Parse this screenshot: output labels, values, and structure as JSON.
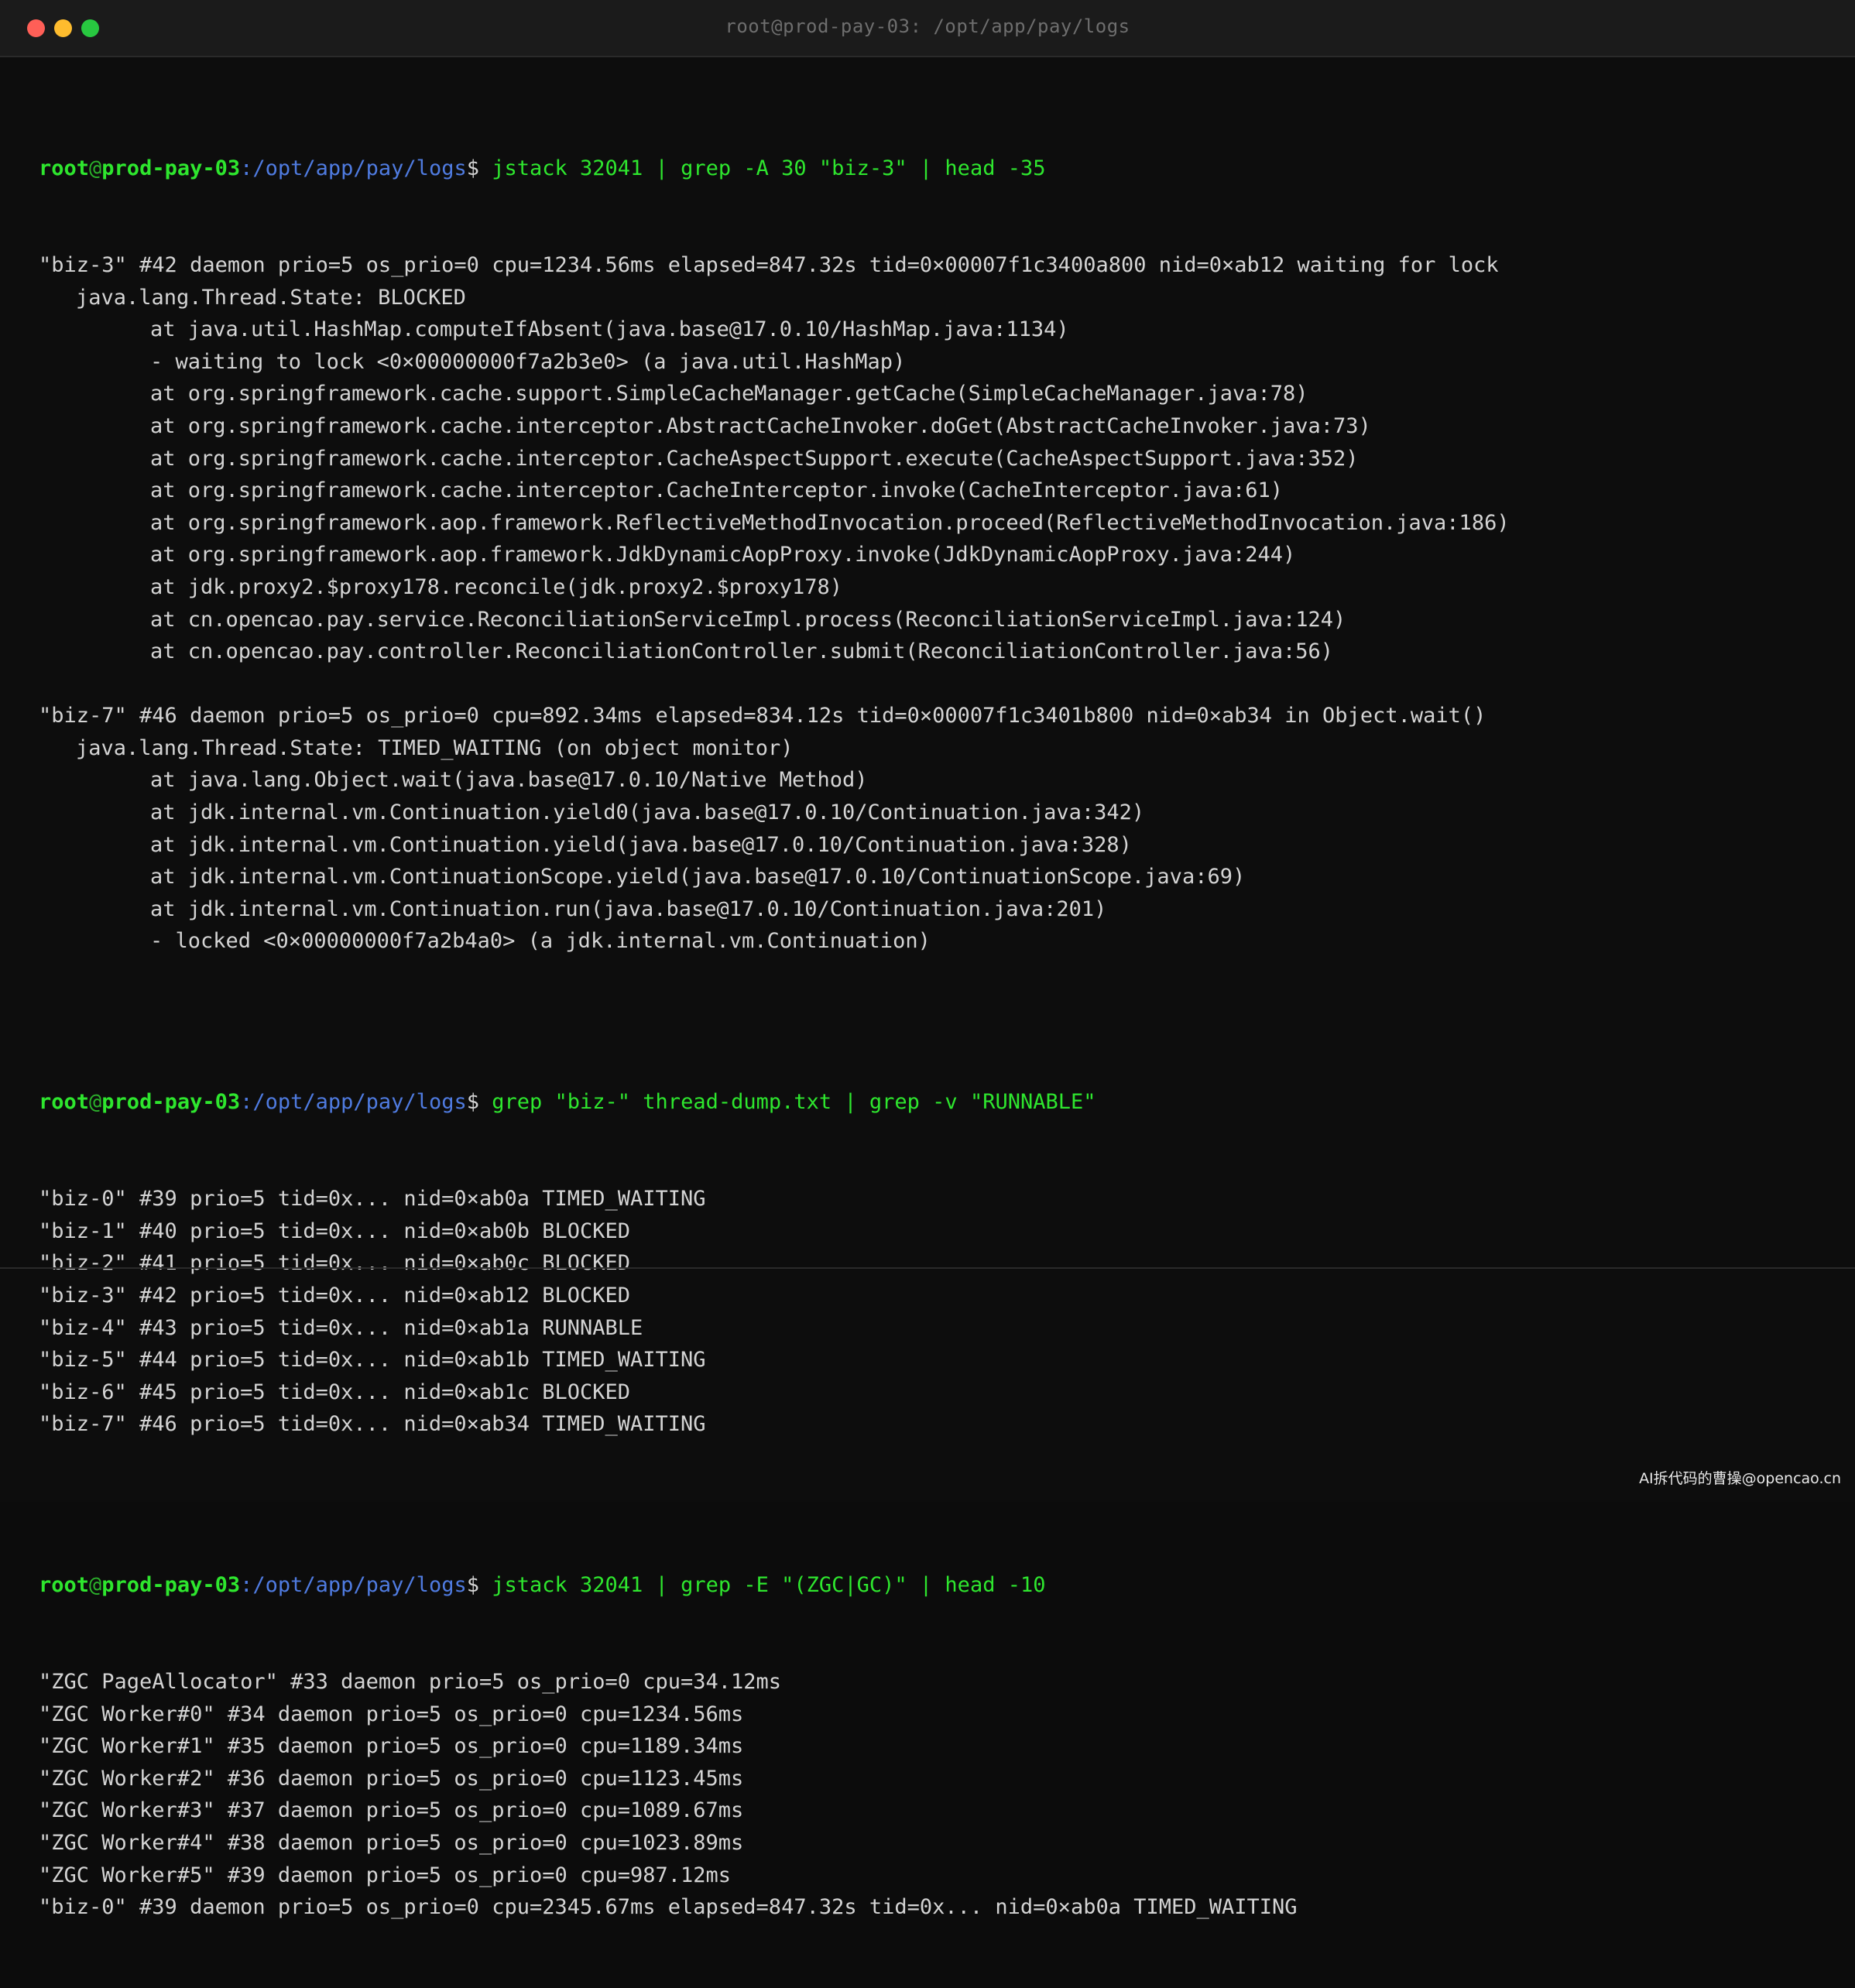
{
  "window": {
    "title": "root@prod-pay-03: /opt/app/pay/logs"
  },
  "prompt": {
    "user": "root",
    "at": "@",
    "host": "prod-pay-03",
    "path": ":/opt/app/pay/logs",
    "dollar": "$ "
  },
  "commands": {
    "cmd1": "jstack 32041 | grep -A 30 \"biz-3\" | head -35",
    "cmd2": "grep \"biz-\" thread-dump.txt | grep -v \"RUNNABLE\"",
    "cmd3": "jstack 32041 | grep -E \"(ZGC|GC)\" | head -10"
  },
  "block1": [
    {
      "indent": 0,
      "text": "\"biz-3\" #42 daemon prio=5 os_prio=0 cpu=1234.56ms elapsed=847.32s tid=0×00007f1c3400a800 nid=0×ab12 waiting for lock"
    },
    {
      "indent": 1,
      "text": "java.lang.Thread.State: BLOCKED"
    },
    {
      "indent": 2,
      "text": "at java.util.HashMap.computeIfAbsent(java.base@17.0.10/HashMap.java:1134)"
    },
    {
      "indent": 2,
      "text": "- waiting to lock <0×00000000f7a2b3e0> (a java.util.HashMap)"
    },
    {
      "indent": 2,
      "text": "at org.springframework.cache.support.SimpleCacheManager.getCache(SimpleCacheManager.java:78)"
    },
    {
      "indent": 2,
      "text": "at org.springframework.cache.interceptor.AbstractCacheInvoker.doGet(AbstractCacheInvoker.java:73)"
    },
    {
      "indent": 2,
      "text": "at org.springframework.cache.interceptor.CacheAspectSupport.execute(CacheAspectSupport.java:352)"
    },
    {
      "indent": 2,
      "text": "at org.springframework.cache.interceptor.CacheInterceptor.invoke(CacheInterceptor.java:61)"
    },
    {
      "indent": 2,
      "text": "at org.springframework.aop.framework.ReflectiveMethodInvocation.proceed(ReflectiveMethodInvocation.java:186)"
    },
    {
      "indent": 2,
      "text": "at org.springframework.aop.framework.JdkDynamicAopProxy.invoke(JdkDynamicAopProxy.java:244)"
    },
    {
      "indent": 2,
      "text": "at jdk.proxy2.$proxy178.reconcile(jdk.proxy2.$proxy178)"
    },
    {
      "indent": 2,
      "text": "at cn.opencao.pay.service.ReconciliationServiceImpl.process(ReconciliationServiceImpl.java:124)"
    },
    {
      "indent": 2,
      "text": "at cn.opencao.pay.controller.ReconciliationController.submit(ReconciliationController.java:56)"
    },
    {
      "indent": 0,
      "text": ""
    },
    {
      "indent": 0,
      "text": "\"biz-7\" #46 daemon prio=5 os_prio=0 cpu=892.34ms elapsed=834.12s tid=0×00007f1c3401b800 nid=0×ab34 in Object.wait()"
    },
    {
      "indent": 1,
      "text": "java.lang.Thread.State: TIMED_WAITING (on object monitor)"
    },
    {
      "indent": 2,
      "text": "at java.lang.Object.wait(java.base@17.0.10/Native Method)"
    },
    {
      "indent": 2,
      "text": "at jdk.internal.vm.Continuation.yield0(java.base@17.0.10/Continuation.java:342)"
    },
    {
      "indent": 2,
      "text": "at jdk.internal.vm.Continuation.yield(java.base@17.0.10/Continuation.java:328)"
    },
    {
      "indent": 2,
      "text": "at jdk.internal.vm.ContinuationScope.yield(java.base@17.0.10/ContinuationScope.java:69)"
    },
    {
      "indent": 2,
      "text": "at jdk.internal.vm.Continuation.run(java.base@17.0.10/Continuation.java:201)"
    },
    {
      "indent": 2,
      "text": "- locked <0×00000000f7a2b4a0> (a jdk.internal.vm.Continuation)"
    },
    {
      "indent": 0,
      "text": ""
    }
  ],
  "block2": [
    {
      "indent": 0,
      "text": "\"biz-0\" #39 prio=5 tid=0x... nid=0×ab0a TIMED_WAITING"
    },
    {
      "indent": 0,
      "text": "\"biz-1\" #40 prio=5 tid=0x... nid=0×ab0b BLOCKED"
    },
    {
      "indent": 0,
      "text": "\"biz-2\" #41 prio=5 tid=0x... nid=0×ab0c BLOCKED"
    },
    {
      "indent": 0,
      "text": "\"biz-3\" #42 prio=5 tid=0x... nid=0×ab12 BLOCKED"
    },
    {
      "indent": 0,
      "text": "\"biz-4\" #43 prio=5 tid=0x... nid=0×ab1a RUNNABLE"
    },
    {
      "indent": 0,
      "text": "\"biz-5\" #44 prio=5 tid=0x... nid=0×ab1b TIMED_WAITING"
    },
    {
      "indent": 0,
      "text": "\"biz-6\" #45 prio=5 tid=0x... nid=0×ab1c BLOCKED"
    },
    {
      "indent": 0,
      "text": "\"biz-7\" #46 prio=5 tid=0x... nid=0×ab34 TIMED_WAITING"
    },
    {
      "indent": 0,
      "text": ""
    }
  ],
  "block3": [
    {
      "indent": 0,
      "text": "\"ZGC PageAllocator\" #33 daemon prio=5 os_prio=0 cpu=34.12ms"
    },
    {
      "indent": 0,
      "text": "\"ZGC Worker#0\" #34 daemon prio=5 os_prio=0 cpu=1234.56ms"
    },
    {
      "indent": 0,
      "text": "\"ZGC Worker#1\" #35 daemon prio=5 os_prio=0 cpu=1189.34ms"
    },
    {
      "indent": 0,
      "text": "\"ZGC Worker#2\" #36 daemon prio=5 os_prio=0 cpu=1123.45ms"
    },
    {
      "indent": 0,
      "text": "\"ZGC Worker#3\" #37 daemon prio=5 os_prio=0 cpu=1089.67ms"
    },
    {
      "indent": 0,
      "text": "\"ZGC Worker#4\" #38 daemon prio=5 os_prio=0 cpu=1023.89ms"
    },
    {
      "indent": 0,
      "text": "\"ZGC Worker#5\" #39 daemon prio=5 os_prio=0 cpu=987.12ms"
    },
    {
      "indent": 0,
      "text": "\"biz-0\" #39 daemon prio=5 os_prio=0 cpu=2345.67ms elapsed=847.32s tid=0x... nid=0×ab0a TIMED_WAITING"
    }
  ],
  "watermark": "AI拆代码的曹操@opencao.cn",
  "colors": {
    "background": "#0d0d0d",
    "titlebar": "#1b1b1b",
    "prompt_green": "#2ee62e",
    "path_blue": "#4f7be0",
    "text": "#d4d4d4",
    "close": "#ff5f57",
    "minimize": "#febc2e",
    "maximize": "#28c840"
  }
}
